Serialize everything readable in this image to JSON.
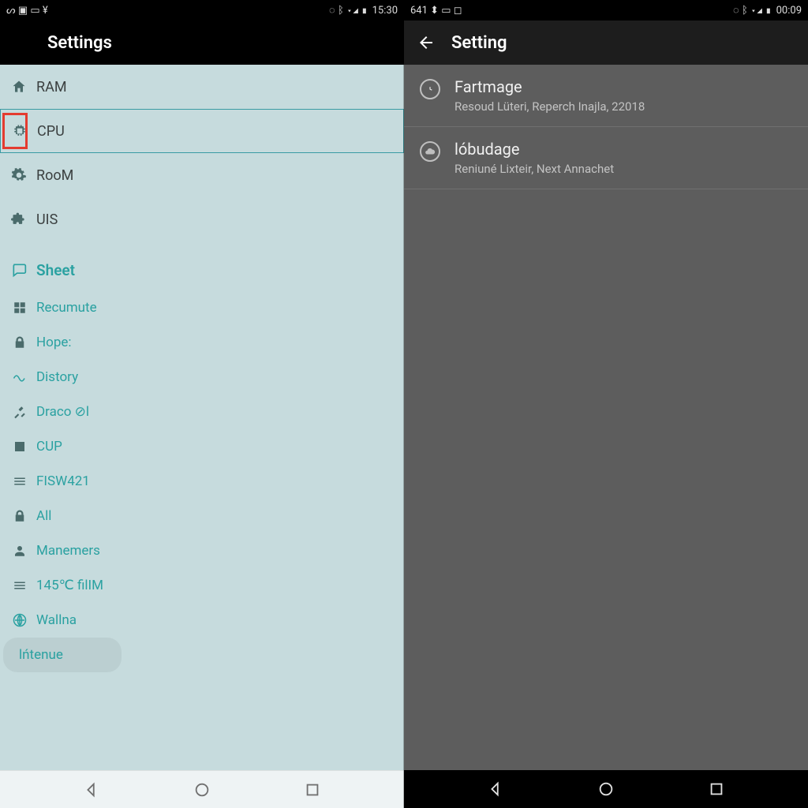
{
  "left": {
    "status": {
      "left_glyphs": "ᔕ ▣ ▭ ¥",
      "right_glyphs": "◌ ᛒ ▾◢ ▮",
      "time": "15:30"
    },
    "appbar": {
      "title": "Settings"
    },
    "primary": [
      {
        "label": "RAM",
        "icon": "home"
      },
      {
        "label": "CPU",
        "icon": "chip",
        "selected": true,
        "red_box": true
      },
      {
        "label": "RooM",
        "icon": "gear"
      },
      {
        "label": "UIS",
        "icon": "puzzle"
      }
    ],
    "section": {
      "label": "Sheet",
      "icon": "chat"
    },
    "subs": [
      {
        "label": "Recumute",
        "icon": "grid"
      },
      {
        "label": "Hope:",
        "icon": "lock"
      },
      {
        "label": "Distory",
        "icon": "wave"
      },
      {
        "label": "Draco ⊘l",
        "icon": "tools"
      },
      {
        "label": "CUP",
        "icon": "down-box"
      },
      {
        "label": "FISW421",
        "icon": "lines"
      },
      {
        "label": "All",
        "icon": "lock"
      },
      {
        "label": "Manemers",
        "icon": "person"
      },
      {
        "label": "145℃ filIM",
        "icon": "lines"
      },
      {
        "label": "Wallna",
        "icon": "globe"
      },
      {
        "label": "lńtenue",
        "icon": "",
        "pill": true
      }
    ]
  },
  "right": {
    "status": {
      "left_glyphs": "641 ⬍ ▭ ◻",
      "right_glyphs": "◌ ᛒ ▾◢ ▮",
      "time": "00:09"
    },
    "appbar": {
      "title": "Setting"
    },
    "items": [
      {
        "title": "Fartmage",
        "subtitle": "Resoud Lüteri, Reperch Inajla, 22018",
        "icon": "clock"
      },
      {
        "title": "lóbudage",
        "subtitle": "Reniuné Lixteir, Next Annachet",
        "icon": "cloud"
      }
    ]
  }
}
